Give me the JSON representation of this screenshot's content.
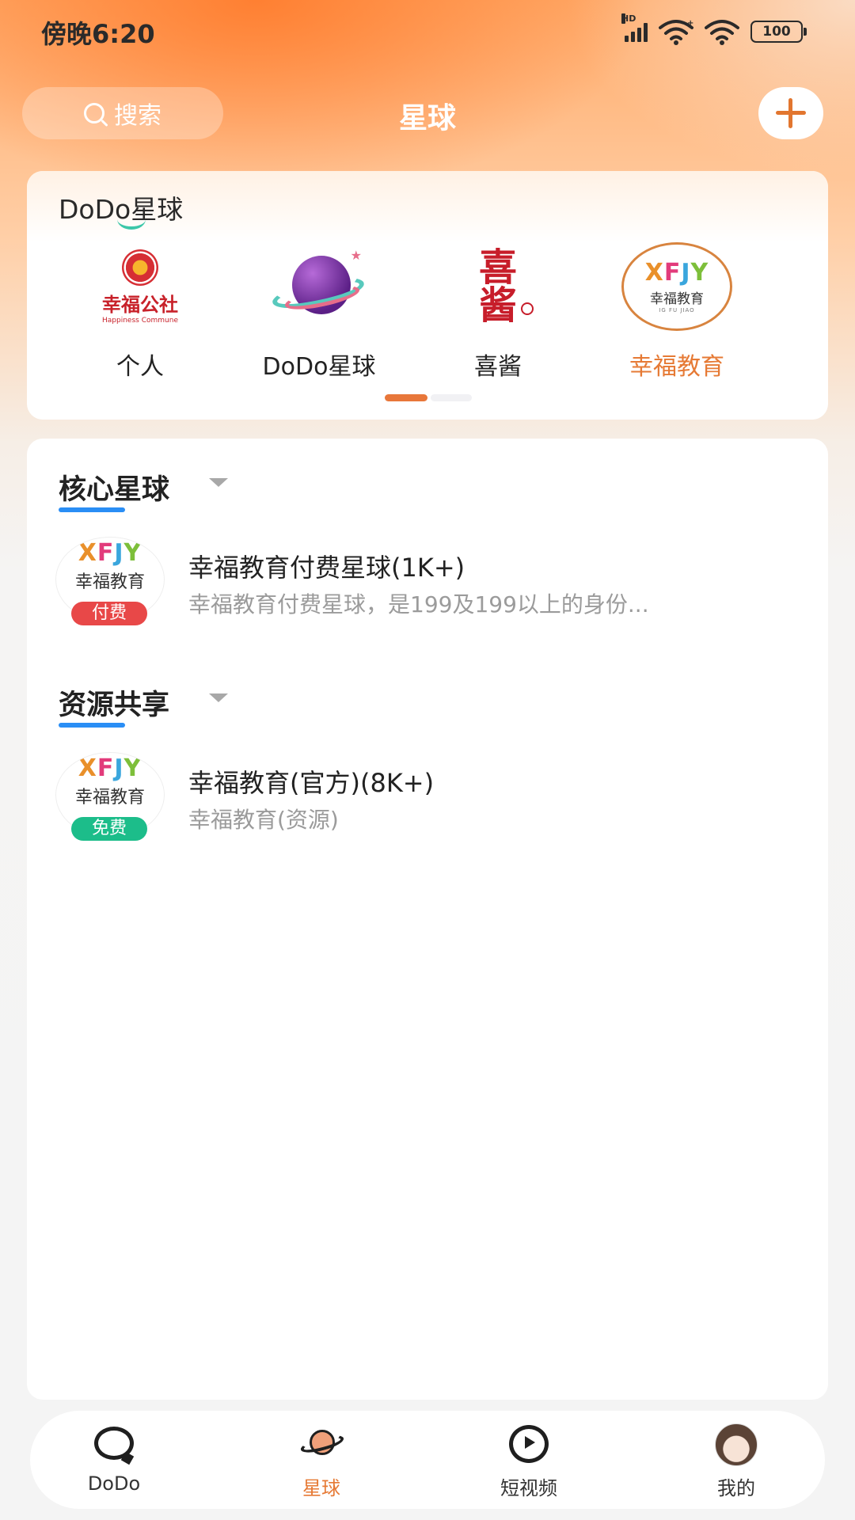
{
  "status_bar": {
    "time": "傍晚6:20",
    "hd_label": "HD",
    "battery": "100"
  },
  "header": {
    "search_placeholder": "搜索",
    "title": "星球"
  },
  "planets_card": {
    "title": "DoDo星球",
    "items": [
      {
        "label": "个人",
        "logo_text": "幸福公社",
        "logo_subtext": "Happiness Commune"
      },
      {
        "label": "DoDo星球"
      },
      {
        "label": "喜酱",
        "logo_text": "喜\n酱"
      },
      {
        "label": "幸福教育",
        "logo_text": "幸福教育",
        "logo_subtext": "IG FU JIAO",
        "active": true
      }
    ],
    "page_index": 0,
    "page_count": 2
  },
  "sections": [
    {
      "title": "核心星球",
      "items": [
        {
          "title": "幸福教育付费星球(1K+)",
          "desc": "幸福教育付费星球，是199及199以上的身份...",
          "tag": "付费",
          "avatar_text": "幸福教育"
        }
      ]
    },
    {
      "title": "资源共享",
      "items": [
        {
          "title": "幸福教育(官方)(8K+)",
          "desc": "幸福教育(资源)",
          "tag": "免费",
          "avatar_text": "幸福教育"
        }
      ]
    }
  ],
  "bottom_nav": [
    {
      "label": "DoDo",
      "icon": "chat-bubble-icon"
    },
    {
      "label": "星球",
      "icon": "planet-icon",
      "active": true
    },
    {
      "label": "短视频",
      "icon": "play-circle-icon"
    },
    {
      "label": "我的",
      "icon": "avatar-icon"
    }
  ],
  "colors": {
    "accent": "#e67a35",
    "paid_tag": "#e84848",
    "free_tag": "#1cbd8a",
    "section_underline": "#2a8ef5"
  }
}
